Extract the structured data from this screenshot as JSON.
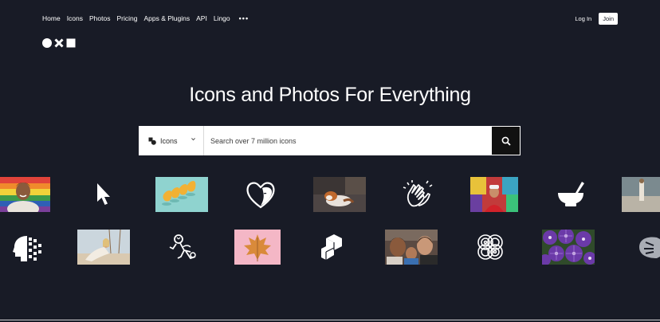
{
  "nav": {
    "links": [
      "Home",
      "Icons",
      "Photos",
      "Pricing",
      "Apps & Plugins",
      "API",
      "Lingo"
    ],
    "more": "•••",
    "login": "Log In",
    "join": "Join"
  },
  "hero": {
    "title": "Icons and Photos For Everything"
  },
  "search": {
    "type_label": "Icons",
    "placeholder": "Search over 7 million icons"
  },
  "colors": {
    "background": "#181b26",
    "search_button": "#111111",
    "join_button": "#ffffff"
  },
  "gallery": {
    "row1": [
      "rainbow-portrait-photo",
      "cursor-arrow-icon",
      "yellow-pears-photo",
      "heart-face-icon",
      "dog-on-couch-photo",
      "clapping-hands-icon",
      "graffiti-man-photo",
      "mortar-pestle-icon",
      "beach-person-photo"
    ],
    "row2": [
      "digital-head-icon",
      "woman-swing-photo",
      "drawn-figure-icon",
      "autumn-leaf-photo",
      "cube-blocks-icon",
      "family-photo",
      "interlocking-circles-icon",
      "purple-flowers-photo",
      "monstera-leaf-icon"
    ]
  }
}
